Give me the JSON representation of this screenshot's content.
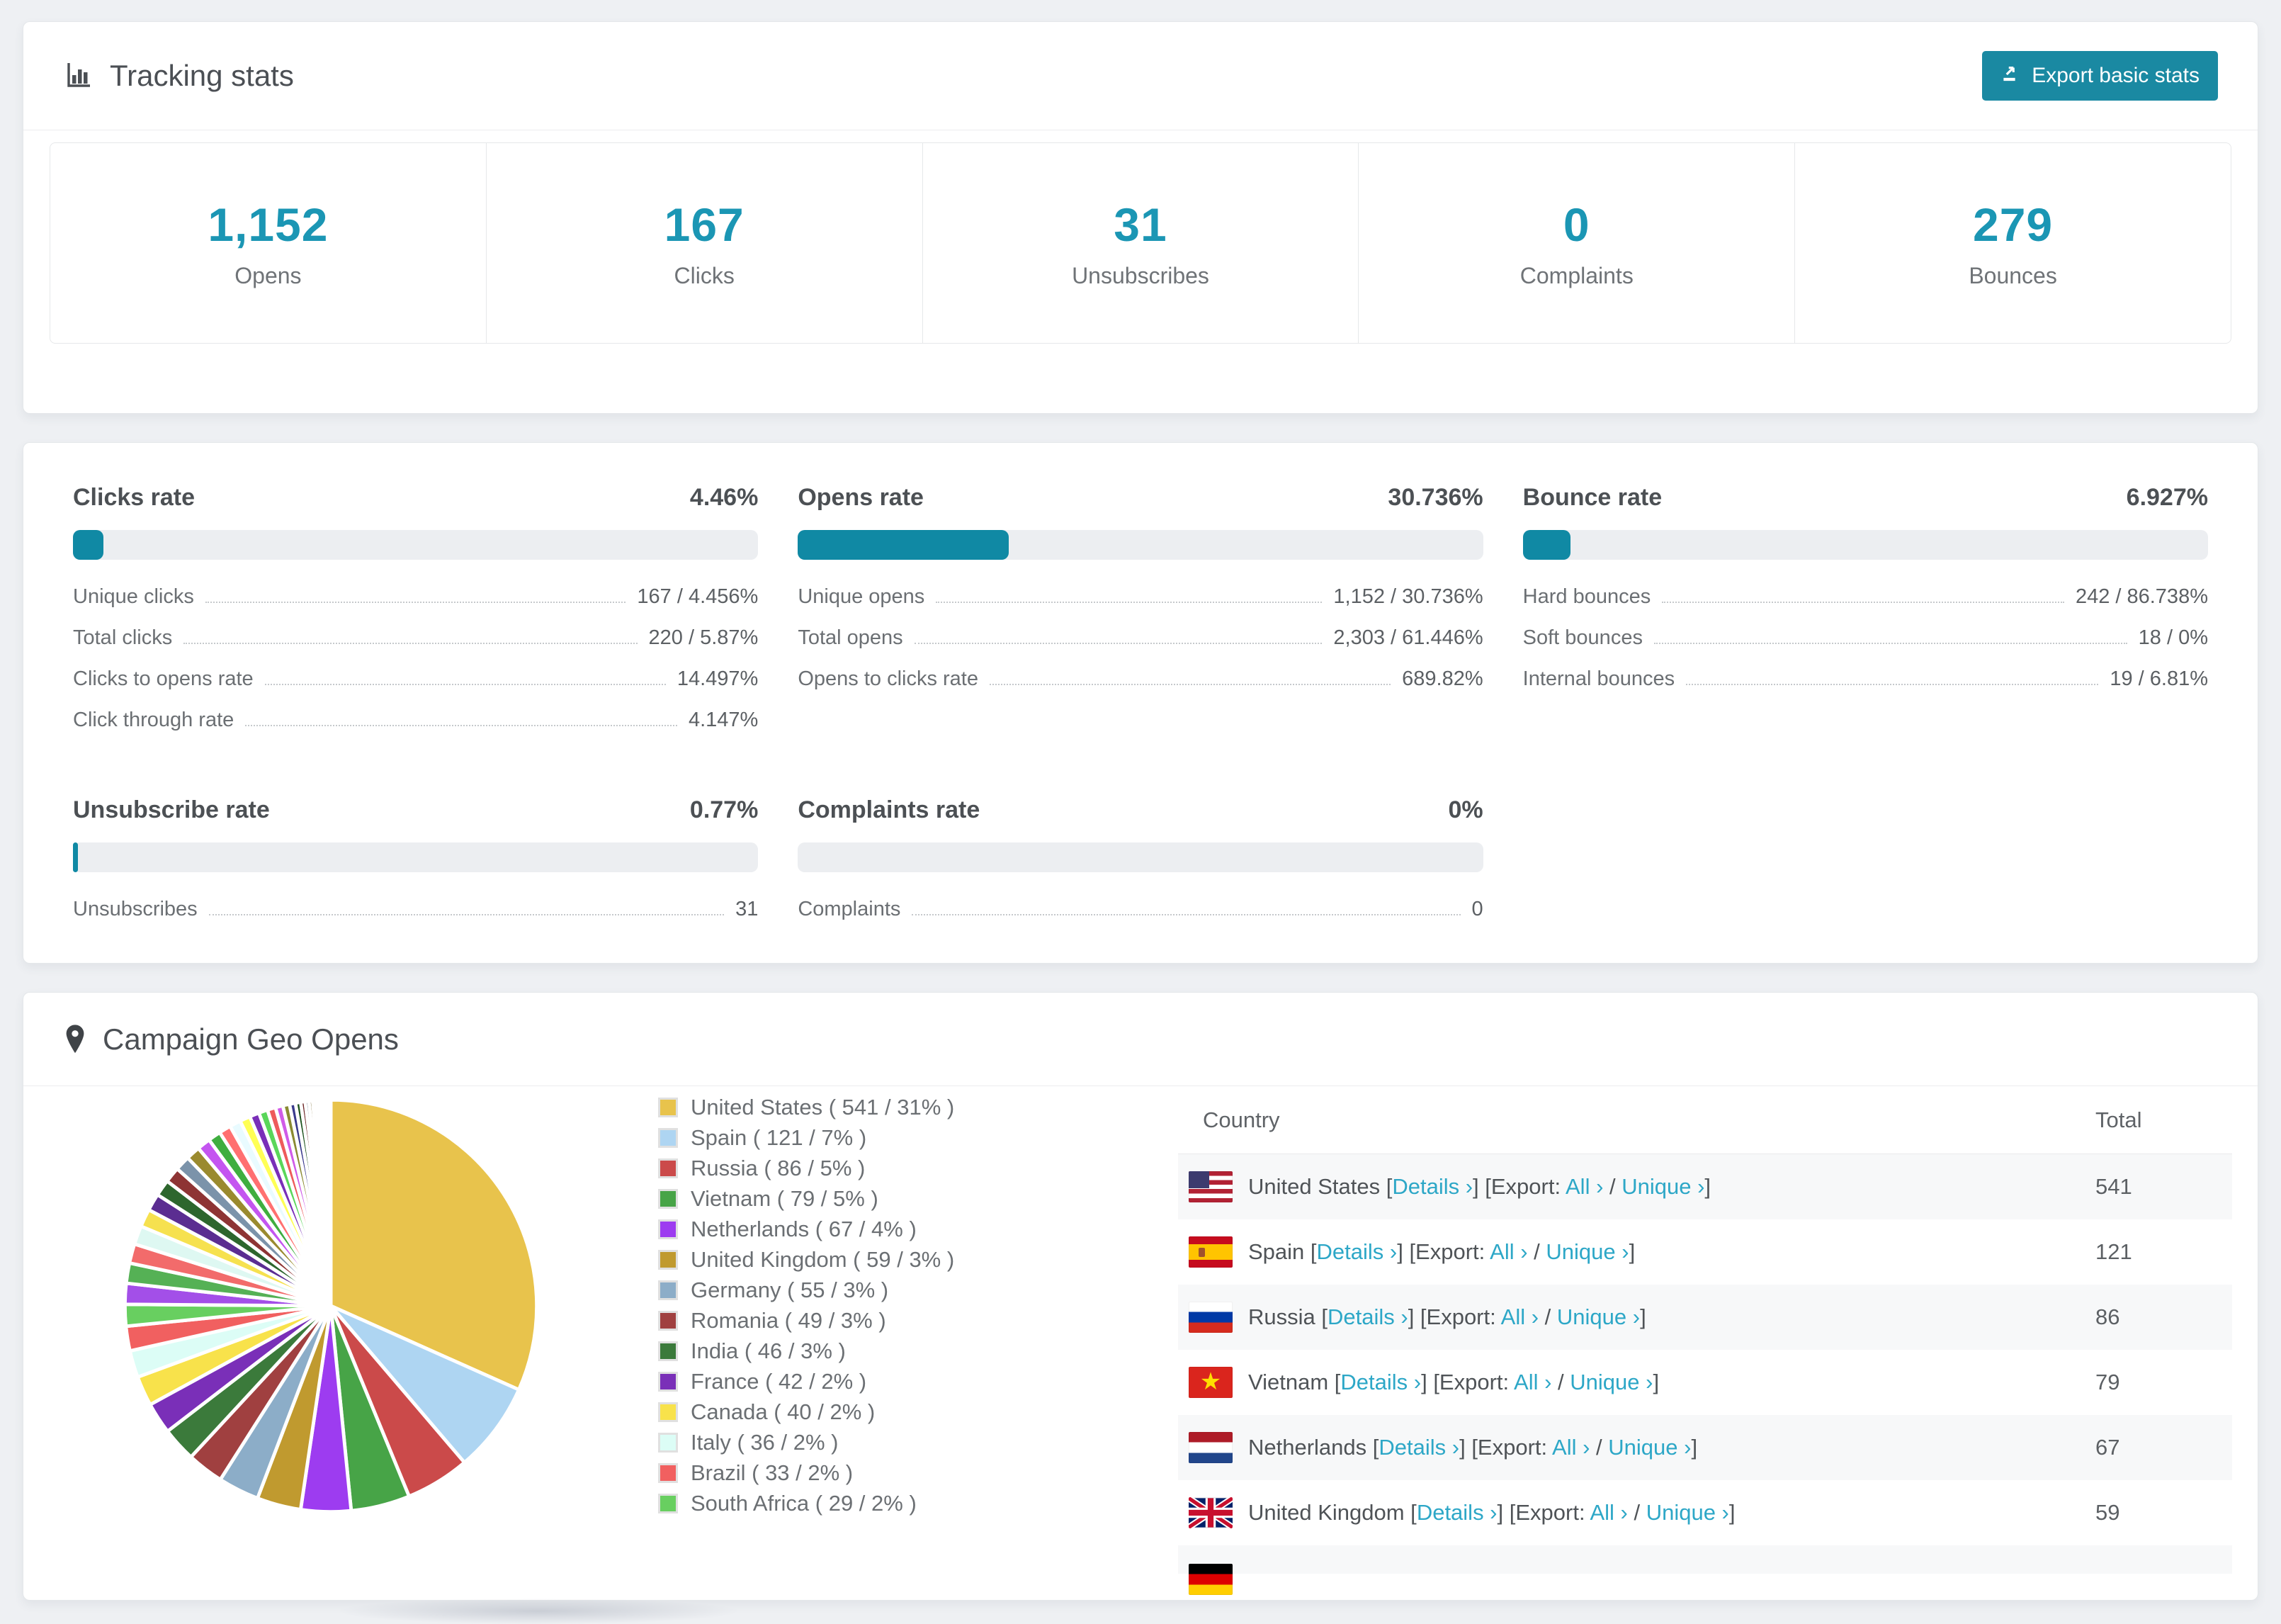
{
  "header": {
    "title": "Tracking stats",
    "export_label": "Export basic stats"
  },
  "summary": [
    {
      "value": "1,152",
      "label": "Opens"
    },
    {
      "value": "167",
      "label": "Clicks"
    },
    {
      "value": "31",
      "label": "Unsubscribes"
    },
    {
      "value": "0",
      "label": "Complaints"
    },
    {
      "value": "279",
      "label": "Bounces"
    }
  ],
  "rates": [
    {
      "title": "Clicks rate",
      "value": "4.46%",
      "percent": 4.46,
      "rows": [
        {
          "label": "Unique clicks",
          "value": "167 / 4.456%"
        },
        {
          "label": "Total clicks",
          "value": "220 / 5.87%"
        },
        {
          "label": "Clicks to opens rate",
          "value": "14.497%"
        },
        {
          "label": "Click through rate",
          "value": "4.147%"
        }
      ]
    },
    {
      "title": "Opens rate",
      "value": "30.736%",
      "percent": 30.736,
      "rows": [
        {
          "label": "Unique opens",
          "value": "1,152 / 30.736%"
        },
        {
          "label": "Total opens",
          "value": "2,303 / 61.446%"
        },
        {
          "label": "Opens to clicks rate",
          "value": "689.82%"
        }
      ]
    },
    {
      "title": "Bounce rate",
      "value": "6.927%",
      "percent": 6.927,
      "rows": [
        {
          "label": "Hard bounces",
          "value": "242 / 86.738%"
        },
        {
          "label": "Soft bounces",
          "value": "18 / 0%"
        },
        {
          "label": "Internal bounces",
          "value": "19 / 6.81%"
        }
      ]
    },
    {
      "title": "Unsubscribe rate",
      "value": "0.77%",
      "percent": 0.77,
      "rows": [
        {
          "label": "Unsubscribes",
          "value": "31"
        }
      ]
    },
    {
      "title": "Complaints rate",
      "value": "0%",
      "percent": 0,
      "rows": [
        {
          "label": "Complaints",
          "value": "0"
        }
      ]
    }
  ],
  "geo": {
    "title": "Campaign Geo Opens",
    "table": {
      "country_header": "Country",
      "total_header": "Total",
      "links": {
        "details": "Details ›",
        "export_prefix": "Export:",
        "all": "All ›",
        "unique": "Unique ›",
        "sep": "/"
      },
      "rows": [
        {
          "country": "United States",
          "flag": "us",
          "total": "541"
        },
        {
          "country": "Spain",
          "flag": "es",
          "total": "121"
        },
        {
          "country": "Russia",
          "flag": "ru",
          "total": "86"
        },
        {
          "country": "Vietnam",
          "flag": "vn",
          "total": "79"
        },
        {
          "country": "Netherlands",
          "flag": "nl",
          "total": "67"
        },
        {
          "country": "United Kingdom",
          "flag": "gb",
          "total": "59"
        },
        {
          "flag": "de",
          "partial": true
        }
      ]
    }
  },
  "chart_data": {
    "type": "pie",
    "title": "Campaign Geo Opens",
    "legend_position": "right",
    "series": [
      {
        "name": "United States",
        "value": 541,
        "pct": "31%",
        "color": "#e8c34c"
      },
      {
        "name": "Spain",
        "value": 121,
        "pct": "7%",
        "color": "#aed5f2"
      },
      {
        "name": "Russia",
        "value": 86,
        "pct": "5%",
        "color": "#cb4a4a"
      },
      {
        "name": "Vietnam",
        "value": 79,
        "pct": "5%",
        "color": "#47a447"
      },
      {
        "name": "Netherlands",
        "value": 67,
        "pct": "4%",
        "color": "#9d3cf0"
      },
      {
        "name": "United Kingdom",
        "value": 59,
        "pct": "3%",
        "color": "#c09a2f"
      },
      {
        "name": "Germany",
        "value": 55,
        "pct": "3%",
        "color": "#8cadc8"
      },
      {
        "name": "Romania",
        "value": 49,
        "pct": "3%",
        "color": "#a04040"
      },
      {
        "name": "India",
        "value": 46,
        "pct": "3%",
        "color": "#3b7a3b"
      },
      {
        "name": "France",
        "value": 42,
        "pct": "2%",
        "color": "#7a2fb8"
      },
      {
        "name": "Canada",
        "value": 40,
        "pct": "2%",
        "color": "#f8e24b"
      },
      {
        "name": "Italy",
        "value": 36,
        "pct": "2%",
        "color": "#dcfdf6"
      },
      {
        "name": "Brazil",
        "value": 33,
        "pct": "2%",
        "color": "#f16060"
      },
      {
        "name": "South Africa",
        "value": 29,
        "pct": "2%",
        "color": "#68cf60"
      }
    ],
    "others_values": [
      28,
      27,
      26,
      25,
      24,
      23,
      22,
      21,
      20,
      19,
      18,
      17,
      16,
      15,
      14,
      13,
      12,
      11,
      10,
      9,
      8,
      7,
      6,
      5,
      5,
      4,
      4,
      3,
      3,
      2,
      2,
      2,
      1,
      1,
      1,
      1
    ],
    "others_palette": [
      "#a34fe8",
      "#55b155",
      "#f26b6b",
      "#def8f2",
      "#f6e14f",
      "#5b2d91",
      "#2d662d",
      "#8e3434",
      "#7b93aa",
      "#9a8a2e",
      "#c455f0",
      "#3fae3f",
      "#ff7070",
      "#e9fbff",
      "#ffff55",
      "#7a2fb8",
      "#5ad65a",
      "#ee5b5b",
      "#d05be8",
      "#8a8a33",
      "#3a3a8c",
      "#1d521d",
      "#6b2424",
      "#66788a",
      "#77662a",
      "#eeee44",
      "#24246b",
      "#cc3a4a",
      "#38a838",
      "#b03ad0",
      "#c09a2f",
      "#aed4f0",
      "#cb4a4a",
      "#47a447",
      "#9d3cf0",
      "#e8c34c"
    ]
  }
}
